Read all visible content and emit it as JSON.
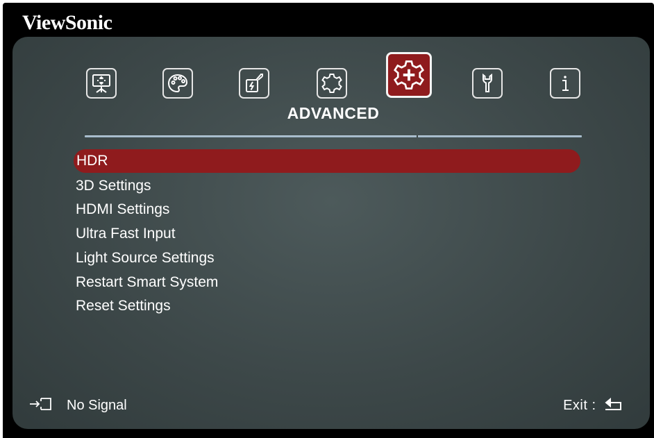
{
  "brand": {
    "name": "ViewSonic"
  },
  "tabs": [
    {
      "icon": "display-icon",
      "active": false
    },
    {
      "icon": "palette-icon",
      "active": false
    },
    {
      "icon": "power-icon",
      "active": false
    },
    {
      "icon": "advanced-gear-icon",
      "active": true
    },
    {
      "icon": "gear-icon",
      "active": false
    },
    {
      "icon": "wrench-icon",
      "active": false
    },
    {
      "icon": "info-icon",
      "active": false
    }
  ],
  "section": {
    "title": "ADVANCED"
  },
  "menu": {
    "selected_index": 0,
    "items": [
      {
        "label": "HDR"
      },
      {
        "label": "3D Settings"
      },
      {
        "label": "HDMI Settings"
      },
      {
        "label": "Ultra Fast Input"
      },
      {
        "label": "Light Source Settings"
      },
      {
        "label": "Restart Smart System"
      },
      {
        "label": "Reset Settings"
      }
    ]
  },
  "footer": {
    "signal_icon": "input-source-icon",
    "signal_text": "No Signal",
    "exit_label": "Exit",
    "exit_separator": ":",
    "exit_icon": "return-arrow-icon"
  },
  "colors": {
    "highlight": "#8f1b1d",
    "panel": "#3d4849",
    "frame": "#000000",
    "text": "#ffffff"
  }
}
